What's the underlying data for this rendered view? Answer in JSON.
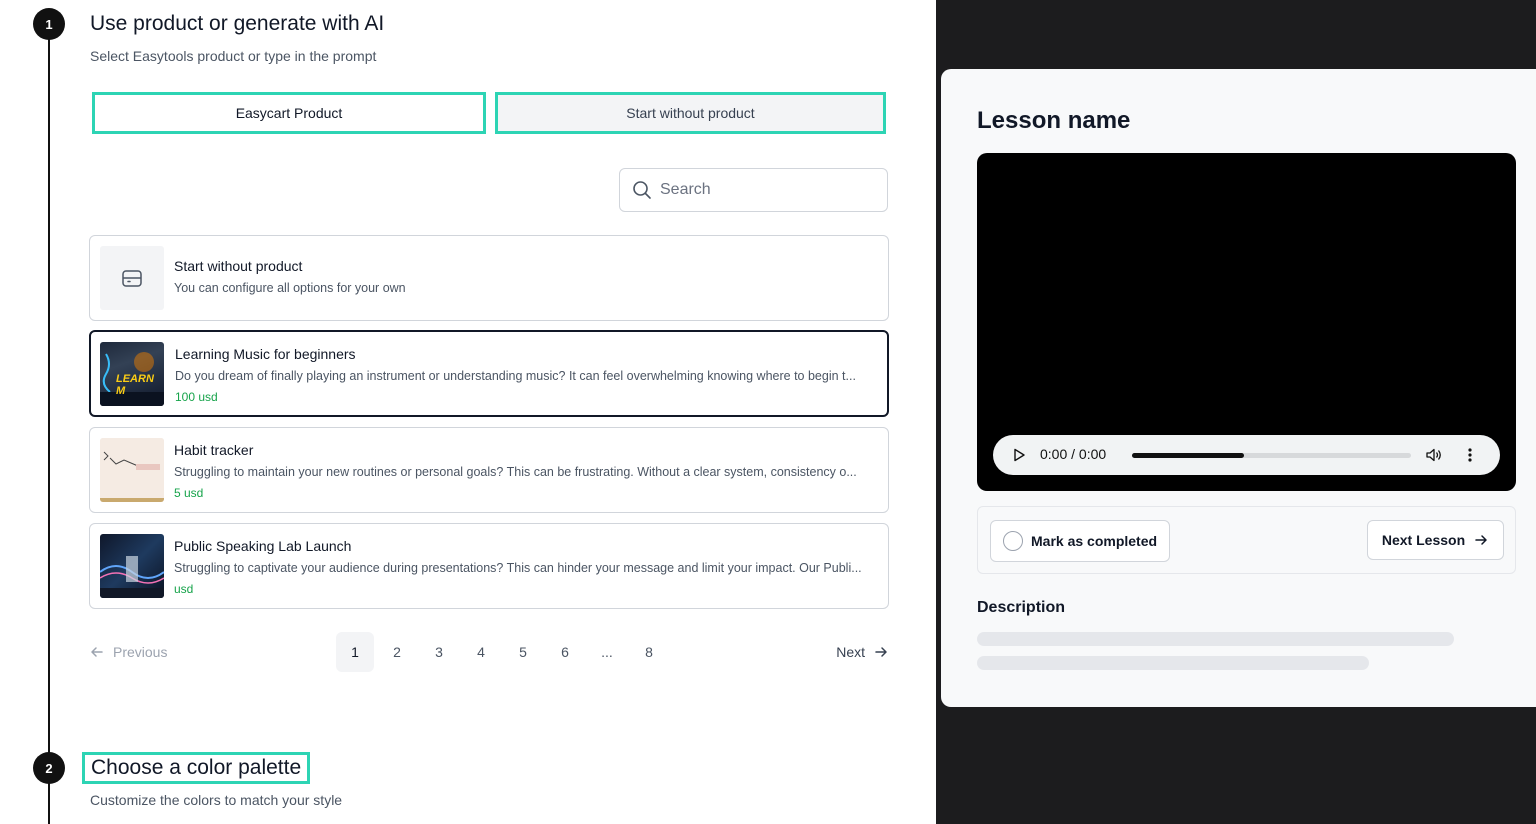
{
  "steps": [
    {
      "number": "1",
      "title": "Use product or generate with AI",
      "subtitle": "Select Easytools product or type in the prompt"
    },
    {
      "number": "2",
      "title": "Choose a color palette",
      "subtitle": "Customize the colors to match your style"
    }
  ],
  "mode_buttons": {
    "easycart": "Easycart Product",
    "without": "Start without product"
  },
  "search": {
    "placeholder": "Search",
    "icon": "search-icon"
  },
  "products": [
    {
      "title": "Start without product",
      "description": "You can configure all options for your own",
      "price": "",
      "icon": "box-icon"
    },
    {
      "title": "Learning Music for beginners",
      "description": "Do you dream of finally playing an instrument or understanding music? It can feel overwhelming knowing where to begin t...",
      "price": "100 usd",
      "thumb_text": "LEARN M",
      "selected": true
    },
    {
      "title": "Habit tracker",
      "description": "Struggling to maintain your new routines or personal goals? This can be frustrating. Without a clear system, consistency o...",
      "price": "5 usd"
    },
    {
      "title": "Public Speaking Lab Launch",
      "description": "Struggling to captivate your audience during presentations? This can hinder your message and limit your impact. Our Publi...",
      "price": "usd"
    }
  ],
  "pagination": {
    "previous": "Previous",
    "next": "Next",
    "pages": [
      "1",
      "2",
      "3",
      "4",
      "5",
      "6",
      "...",
      "8"
    ],
    "current": "1"
  },
  "preview": {
    "lesson_name": "Lesson name",
    "video": {
      "time": "0:00 / 0:00",
      "progress": 0.4
    },
    "mark_completed": "Mark as completed",
    "next_lesson": "Next Lesson",
    "description_label": "Description"
  },
  "colors": {
    "highlight": "#2dd4b4",
    "price": "#16a34a",
    "dark_panel": "#1c1c1e"
  }
}
